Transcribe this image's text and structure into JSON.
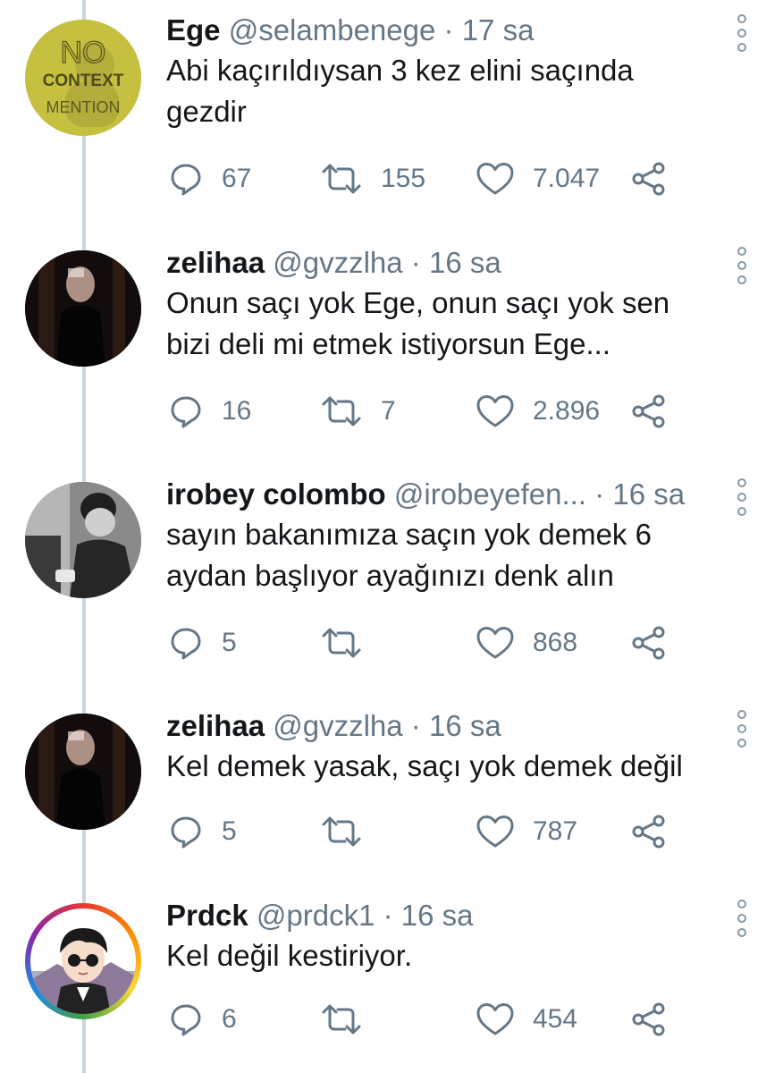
{
  "tweets": [
    {
      "avatar": {
        "type": "logo",
        "lines": [
          "NO",
          "CONTEXT",
          "MENTION"
        ]
      },
      "name": "Ege",
      "handle": "@selambenege",
      "separator": "·",
      "time": "17 sa",
      "lines": [
        "Abi kaçırıldıysan 3 kez elini saçında",
        "gezdir"
      ],
      "replies": "67",
      "retweets": "155",
      "likes": "7.047"
    },
    {
      "avatar": {
        "type": "photo-dark"
      },
      "name": "zelihaa",
      "handle": "@gvzzlha",
      "separator": "·",
      "time": "16 sa",
      "lines": [
        "Onun saçı yok Ege, onun saçı yok sen",
        "bizi deli mi etmek istiyorsun Ege..."
      ],
      "replies": "16",
      "retweets": "7",
      "likes": "2.896"
    },
    {
      "avatar": {
        "type": "photo-gray"
      },
      "name": "irobey colombo",
      "handle": "@irobeyefen...",
      "separator": "·",
      "time": "16 sa",
      "lines": [
        "sayın bakanımıza saçın yok demek 6",
        "aydan başlıyor ayağınızı denk alın"
      ],
      "replies": "5",
      "retweets": "",
      "likes": "868"
    },
    {
      "avatar": {
        "type": "photo-dark"
      },
      "name": "zelihaa",
      "handle": "@gvzzlha",
      "separator": "·",
      "time": "16 sa",
      "lines": [
        "Kel demek yasak, saçı yok demek değil"
      ],
      "replies": "5",
      "retweets": "",
      "likes": "787"
    },
    {
      "avatar": {
        "type": "cartoon"
      },
      "name": "Prdck",
      "handle": "@prdck1",
      "separator": "·",
      "time": "16 sa",
      "lines": [
        "Kel değil kestiriyor."
      ],
      "replies": "6",
      "retweets": "",
      "likes": "454"
    }
  ],
  "icons": {
    "reply": "reply-icon",
    "retweet": "retweet-icon",
    "like": "heart-icon",
    "share": "share-icon",
    "more": "more-vertical-icon"
  },
  "colors": {
    "text": "#14171a",
    "secondary": "#657786",
    "line": "#ccd6dd"
  }
}
